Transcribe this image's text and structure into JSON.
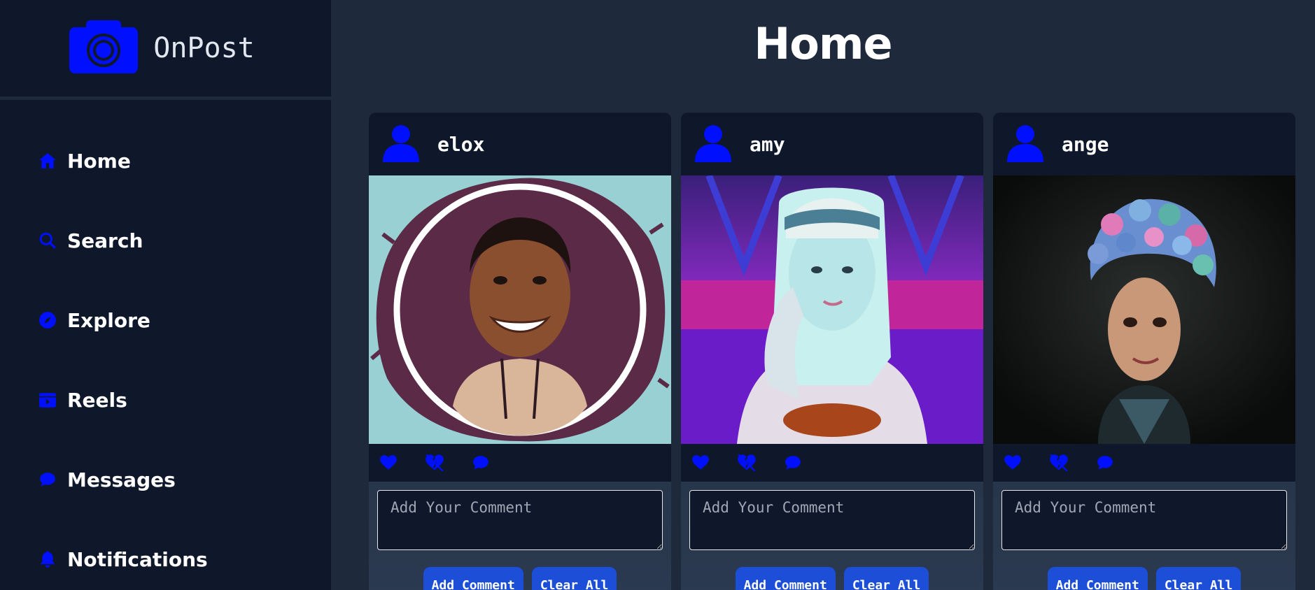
{
  "app": {
    "name": "OnPost",
    "accent_color": "#0010ff",
    "logo_icon": "camera-icon"
  },
  "sidebar": {
    "items": [
      {
        "label": "Home",
        "icon": "home-icon"
      },
      {
        "label": "Search",
        "icon": "search-icon"
      },
      {
        "label": "Explore",
        "icon": "compass-icon"
      },
      {
        "label": "Reels",
        "icon": "reels-icon"
      },
      {
        "label": "Messages",
        "icon": "chat-bubble-icon"
      },
      {
        "label": "Notifications",
        "icon": "bell-icon"
      }
    ]
  },
  "main": {
    "title": "Home",
    "posts": [
      {
        "username": "elox",
        "avatar_icon": "user-icon",
        "comment_placeholder": "Add Your Comment",
        "add_comment_label": "Add Comment",
        "clear_all_label": "Clear All"
      },
      {
        "username": "amy",
        "avatar_icon": "user-icon",
        "comment_placeholder": "Add Your Comment",
        "add_comment_label": "Add Comment",
        "clear_all_label": "Clear All"
      },
      {
        "username": "ange",
        "avatar_icon": "user-icon",
        "comment_placeholder": "Add Your Comment",
        "add_comment_label": "Add Comment",
        "clear_all_label": "Clear All"
      }
    ]
  }
}
